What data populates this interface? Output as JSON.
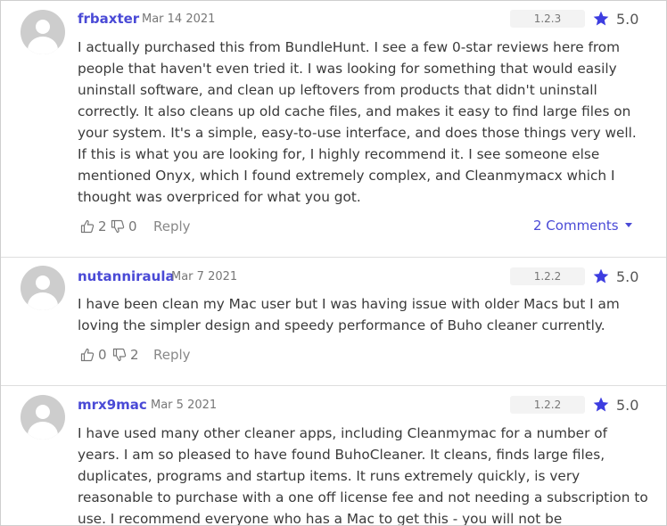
{
  "reviews": [
    {
      "username": "frbaxter",
      "date": "Mar 14 2021",
      "version": "1.2.3",
      "rating": "5.0",
      "text": "I actually purchased this from BundleHunt. I see a few 0-star reviews here from people that haven't even tried it. I was looking for something that would easily uninstall software, and clean up leftovers from products that didn't uninstall correctly. It also cleans up old cache files, and makes it easy to find large files on your system. It's a simple, easy-to-use interface, and does those things very well. If this is what you are looking for, I highly recommend it. I see someone else mentioned Onyx, which I found extremely complex, and Cleanmymacx which I thought was overpriced for what you got.",
      "likes": "2",
      "dislikes": "0",
      "reply_label": "Reply",
      "comments_label": "2 Comments"
    },
    {
      "username": "nutanniraula",
      "date": "Mar 7 2021",
      "version": "1.2.2",
      "rating": "5.0",
      "text": "I have been clean my Mac user but I was having issue with older Macs but I am loving the simpler design and speedy performance of Buho cleaner currently.",
      "likes": "0",
      "dislikes": "2",
      "reply_label": "Reply"
    },
    {
      "username": "mrx9mac",
      "date": "Mar 5 2021",
      "version": "1.2.2",
      "rating": "5.0",
      "text": "I have used many other cleaner apps, including Cleanmymac for a number of years. I am so pleased to have found BuhoCleaner. It cleans, finds large files, duplicates, programs and startup items. It runs extremely quickly, is very reasonable to purchase with a one off license fee and not needing a subscription to use. I recommend everyone who has a Mac to get this - you will not be disappointed."
    }
  ],
  "colors": {
    "accent": "#4a4ad6",
    "star": "#3d3de0",
    "text": "#3a3a3a",
    "muted": "#777777"
  }
}
